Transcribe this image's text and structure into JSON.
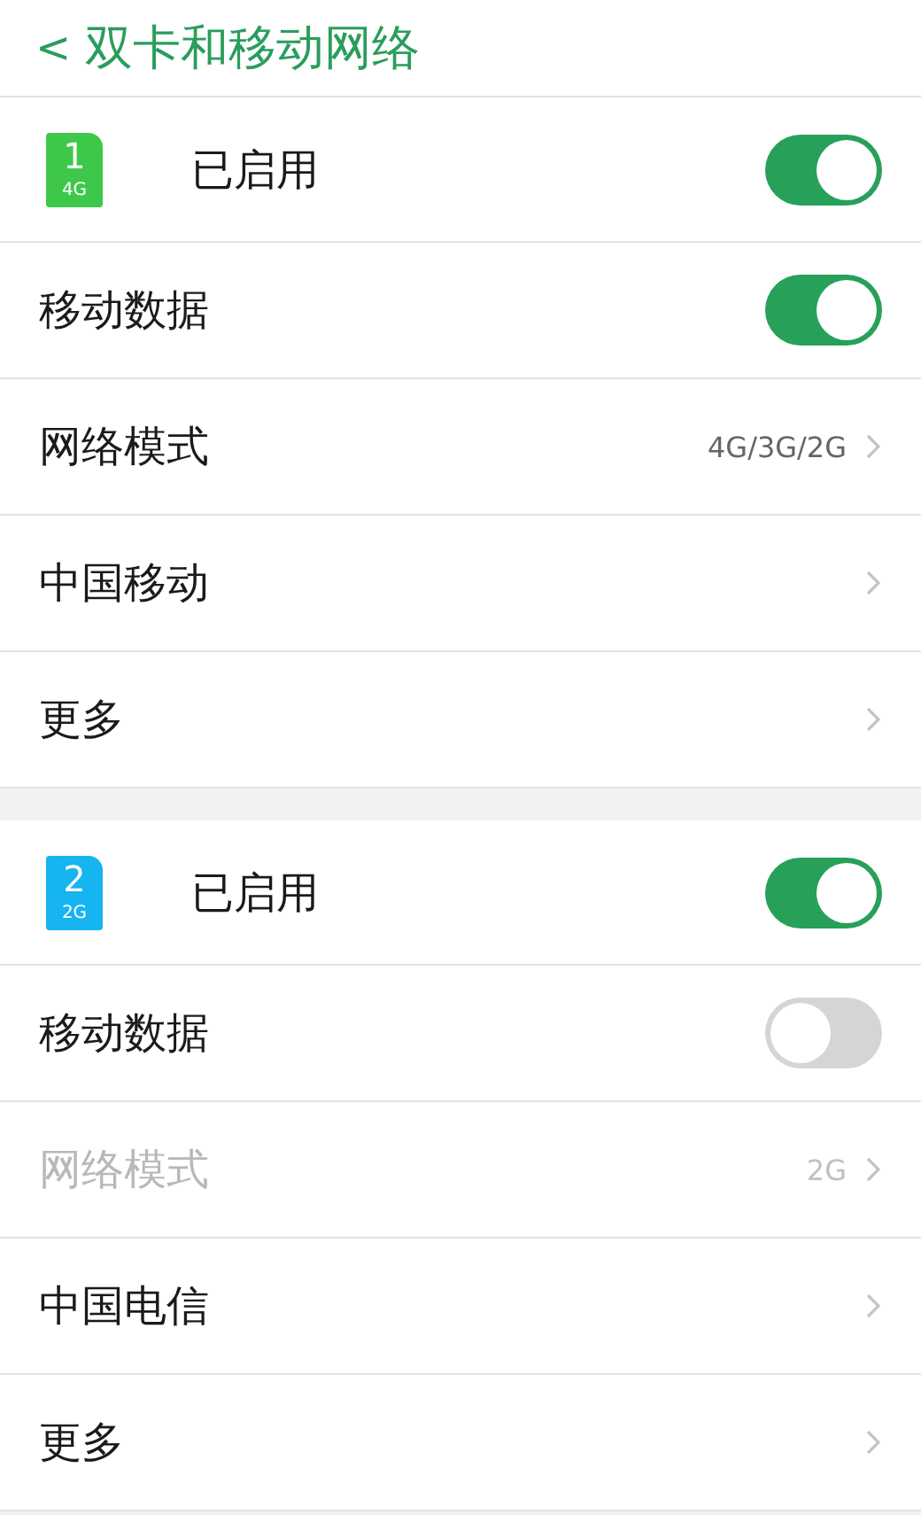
{
  "header": {
    "back_icon": "<",
    "title": "双卡和移动网络"
  },
  "sims": [
    {
      "number": "1",
      "network": "4G",
      "color": "#3ec84a",
      "status": "已启用",
      "enabled": true,
      "rows": [
        {
          "kind": "toggle",
          "label": "移动数据",
          "on": true
        },
        {
          "kind": "link",
          "label": "网络模式",
          "value": "4G/3G/2G",
          "disabled": false
        },
        {
          "kind": "link",
          "label": "中国移动",
          "disabled": false
        },
        {
          "kind": "link",
          "label": "更多",
          "disabled": false
        }
      ]
    },
    {
      "number": "2",
      "network": "2G",
      "color": "#16b4f0",
      "status": "已启用",
      "enabled": true,
      "rows": [
        {
          "kind": "toggle",
          "label": "移动数据",
          "on": false
        },
        {
          "kind": "link",
          "label": "网络模式",
          "value": "2G",
          "disabled": true
        },
        {
          "kind": "link",
          "label": "中国电信",
          "disabled": false
        },
        {
          "kind": "link",
          "label": "更多",
          "disabled": false
        }
      ]
    }
  ]
}
